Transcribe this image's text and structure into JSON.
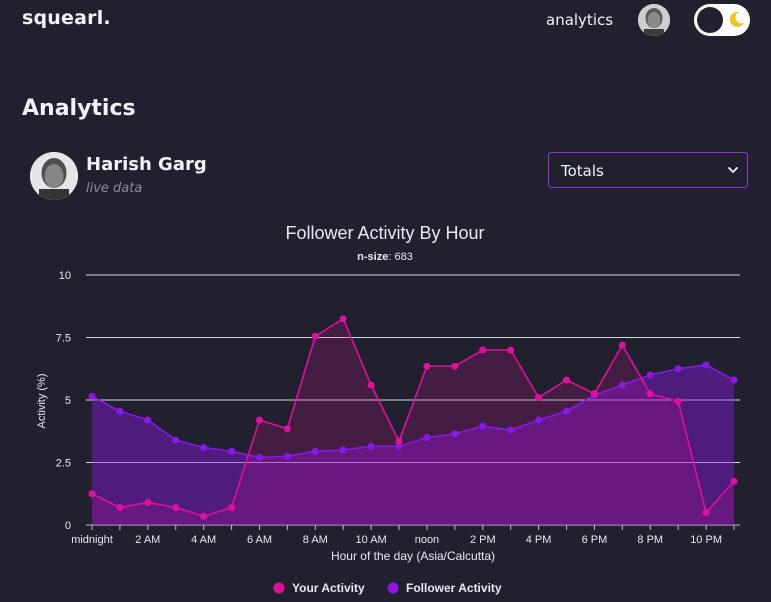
{
  "brand": {
    "name": "squearl."
  },
  "nav": {
    "analytics_label": "analytics"
  },
  "page": {
    "title": "Analytics"
  },
  "profile": {
    "name": "Harish Garg",
    "subtitle": "live data"
  },
  "dropdown": {
    "selected": "Totals"
  },
  "colors": {
    "background": "#21202f",
    "your_activity": "#e0109b",
    "follower_activity": "#8a17e8",
    "accent_border": "#9d2fd7"
  },
  "icons": {
    "moon": "moon-icon",
    "chevron": "chevron-down-icon",
    "avatar": "avatar"
  },
  "chart_data": {
    "type": "area",
    "title": "Follower Activity By Hour",
    "subtitle_label": "n-size",
    "subtitle_value": "683",
    "xlabel": "Hour of the day (Asia/Calcutta)",
    "ylabel": "Activity (%)",
    "ylim": [
      0,
      10
    ],
    "grid": true,
    "legend_position": "bottom",
    "y_ticks": [
      "0",
      "2.5",
      "5",
      "7.5",
      "10"
    ],
    "y_tick_values": [
      0,
      2.5,
      5,
      7.5,
      10
    ],
    "x": [
      0,
      1,
      2,
      3,
      4,
      5,
      6,
      7,
      8,
      9,
      10,
      11,
      12,
      13,
      14,
      15,
      16,
      17,
      18,
      19,
      20,
      21,
      22,
      23
    ],
    "x_tick_labels": [
      "midnight",
      "2 AM",
      "4 AM",
      "6 AM",
      "8 AM",
      "10 AM",
      "noon",
      "2 PM",
      "4 PM",
      "6 PM",
      "8 PM",
      "10 PM"
    ],
    "x_tick_hours": [
      0,
      2,
      4,
      6,
      8,
      10,
      12,
      14,
      16,
      18,
      20,
      22
    ],
    "series": [
      {
        "name": "Your Activity",
        "color": "#e0109b",
        "values": [
          1.25,
          0.7,
          0.9,
          0.7,
          0.35,
          0.7,
          4.2,
          3.85,
          7.55,
          8.25,
          5.6,
          3.35,
          6.35,
          6.35,
          7.0,
          7.0,
          5.1,
          5.8,
          5.25,
          7.2,
          5.25,
          4.95,
          0.5,
          1.75
        ]
      },
      {
        "name": "Follower Activity",
        "color": "#8a17e8",
        "values": [
          5.15,
          4.55,
          4.2,
          3.4,
          3.1,
          2.95,
          2.7,
          2.75,
          2.95,
          3.0,
          3.15,
          3.15,
          3.5,
          3.65,
          3.95,
          3.8,
          4.2,
          4.55,
          5.2,
          5.6,
          6.0,
          6.25,
          6.4,
          5.8
        ]
      }
    ]
  }
}
